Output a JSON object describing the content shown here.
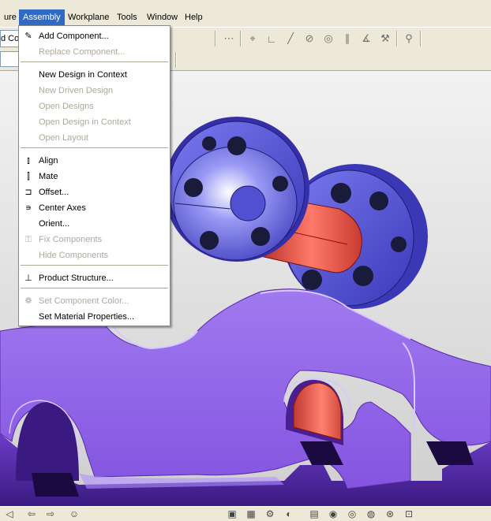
{
  "menubar": {
    "items": [
      {
        "label": "ure",
        "active": false
      },
      {
        "label": "Assembly",
        "active": true
      },
      {
        "label": "Workplane",
        "active": false
      },
      {
        "label": "Tools",
        "active": false
      },
      {
        "label": "Window",
        "active": false
      },
      {
        "label": "Help",
        "active": false
      }
    ]
  },
  "toolbar": {
    "left_field_text": "d Co"
  },
  "assembly_menu": {
    "items": [
      {
        "label": "Add Component...",
        "enabled": true,
        "icon": "add-component-icon"
      },
      {
        "label": "Replace Component...",
        "enabled": false
      },
      {
        "label": "New Design in Context",
        "enabled": true
      },
      {
        "label": "New Driven Design",
        "enabled": false
      },
      {
        "label": "Open Designs",
        "enabled": false
      },
      {
        "label": "Open Design in Context",
        "enabled": false
      },
      {
        "label": "Open Layout",
        "enabled": false
      },
      {
        "label": "Align",
        "enabled": true,
        "icon": "align-icon"
      },
      {
        "label": "Mate",
        "enabled": true,
        "icon": "mate-icon"
      },
      {
        "label": "Offset...",
        "enabled": true,
        "icon": "offset-icon"
      },
      {
        "label": "Center Axes",
        "enabled": true,
        "icon": "center-axes-icon"
      },
      {
        "label": "Orient...",
        "enabled": true
      },
      {
        "label": "Fix Components",
        "enabled": false,
        "icon": "fix-components-icon"
      },
      {
        "label": "Hide Components",
        "enabled": false
      },
      {
        "label": "Product Structure...",
        "enabled": true,
        "icon": "product-structure-icon"
      },
      {
        "label": "Set Component Color...",
        "enabled": false,
        "icon": "color-icon"
      },
      {
        "label": "Set Material Properties...",
        "enabled": true
      }
    ]
  },
  "colors": {
    "menu_highlight": "#316ac5",
    "part_purple": "#8a5ae0",
    "wheel_blue": "#5a5ad8",
    "axle_red": "#e04a40"
  }
}
